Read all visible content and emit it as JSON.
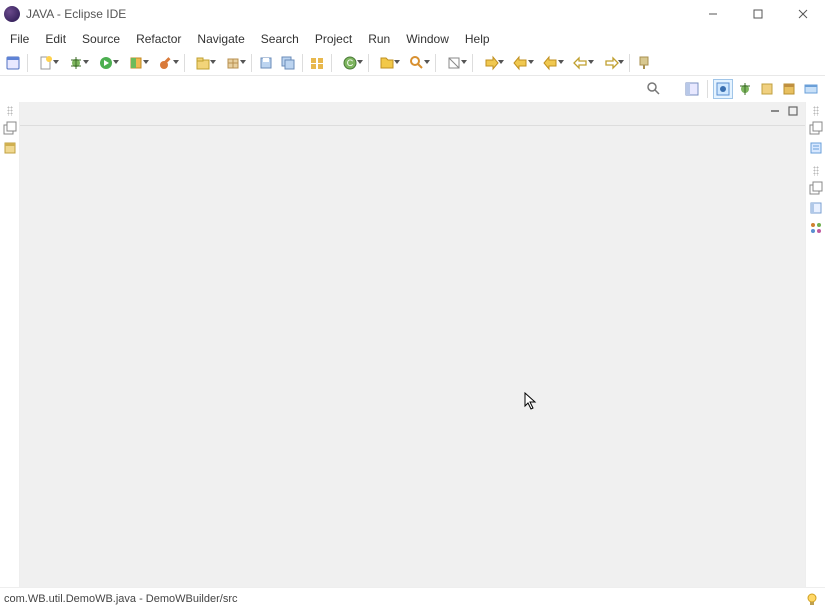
{
  "titlebar": {
    "title": "JAVA - Eclipse IDE"
  },
  "menu": {
    "items": [
      "File",
      "Edit",
      "Source",
      "Refactor",
      "Navigate",
      "Search",
      "Project",
      "Run",
      "Window",
      "Help"
    ]
  },
  "statusbar": {
    "text": "com.WB.util.DemoWB.java - DemoWBuilder/src"
  }
}
